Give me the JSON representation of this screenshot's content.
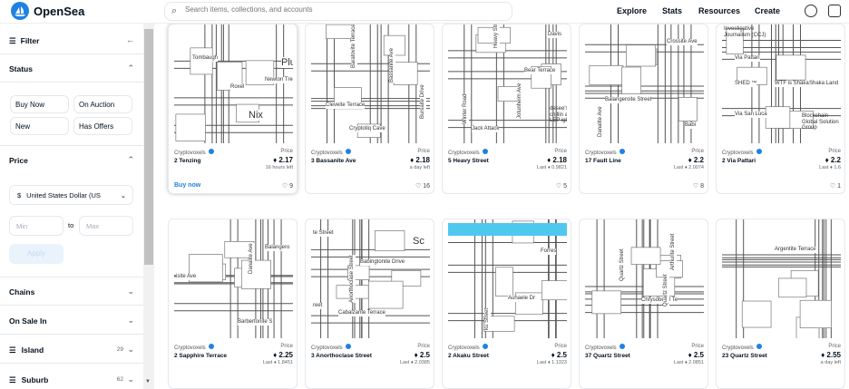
{
  "brand": {
    "name": "OpenSea"
  },
  "search": {
    "placeholder": "Search items, collections, and accounts"
  },
  "nav": [
    "Explore",
    "Stats",
    "Resources",
    "Create"
  ],
  "sidebar": {
    "filter": "Filter",
    "status": "Status",
    "status_options": [
      "Buy Now",
      "On Auction",
      "New",
      "Has Offers"
    ],
    "price": "Price",
    "currency": "United States Dollar (US",
    "currency_symbol": "$",
    "min": "Min",
    "to": "to",
    "max": "Max",
    "apply": "Apply",
    "chains": "Chains",
    "on_sale": "On Sale In",
    "island": "Island",
    "island_count": "29",
    "suburb": "Suburb",
    "suburb_count": "62"
  },
  "cards": [
    {
      "collection": "Cryptovoxels",
      "name": "2 Tenzing",
      "price_label": "Price",
      "price": "2.17",
      "sub": "16 hours left",
      "fav": "9",
      "buy": "Buy now",
      "map": [
        "Tombaugh",
        "Roxel",
        "Newton Tree",
        "Nix",
        "Plu"
      ]
    },
    {
      "collection": "Cryptovoxels",
      "name": "3 Bassanite Ave",
      "price_label": "Price",
      "price": "2.18",
      "sub": "a day left",
      "fav": "16",
      "map": [
        "Baratovite Terrace",
        "Bassanite Ave",
        "Cleveite Terrace",
        "Cryptotiq Cave",
        "Bursaite Drive"
      ]
    },
    {
      "collection": "Cryptovoxels",
      "name": "5 Heavy Street",
      "price_label": "Price",
      "price": "2.18",
      "sub": "Last ♦ 0.9821",
      "fav": "5",
      "map": [
        "Davis",
        "Heavy Street",
        "Bear Terrace",
        "Winter Road",
        "Jack Attack",
        "desee's jus chillin aka LEP igloo",
        "Jotunheim Ave"
      ]
    },
    {
      "collection": "Cryptovoxels",
      "name": "17 Fault Line",
      "price_label": "Price",
      "price": "2.2",
      "sub": "Last ♦ 2.0074",
      "fav": "8",
      "map": [
        "Crossite Ave",
        "Balangeroite Street",
        "Danalite Ave",
        "Babi"
      ]
    },
    {
      "collection": "Cryptovoxels",
      "name": "2 Via Pattari",
      "price_label": "Price",
      "price": "2.2",
      "sub": "Last ♦ 1.6",
      "fav": "1",
      "map": [
        "Investigative Journalism (CCJ)",
        "Via Pattari",
        "SHED ™",
        "WTF is Shaka",
        "Shaka Land",
        "Via San Luca",
        "Blockchain Global Solution Group"
      ]
    },
    {
      "collection": "Cryptovoxels",
      "name": "2 Sapphire Terrace",
      "price_label": "Price",
      "price": "2.25",
      "sub": "Last ♦ 1.8451",
      "map": [
        "Balangero",
        "Danalite Ave",
        "isite Ave",
        "Barbertonite S"
      ]
    },
    {
      "collection": "Cryptovoxels",
      "name": "3 Anorthoclase Street",
      "price_label": "Price",
      "price": "2.5",
      "sub": "Last ♦ 2.0385",
      "map": [
        "te Street",
        "Sc",
        "Babingtonite Drive",
        "Anorthoclase Street",
        "reet",
        "Cabalzarite Terrace"
      ]
    },
    {
      "collection": "Cryptovoxels",
      "name": "2 Akaku Street",
      "price_label": "Price",
      "price": "2.5",
      "sub": "Last ♦ 1.1323",
      "map": [
        "Forres",
        "Auhaele Dr",
        "ku Street"
      ]
    },
    {
      "collection": "Cryptovoxels",
      "name": "37 Quartz Street",
      "price_label": "Price",
      "price": "2.5",
      "sub": "Last ♦ 2.0851",
      "map": [
        "Arthurite Street",
        "Quartz Street",
        "Chrysoberyl Te",
        "Quartz Street"
      ]
    },
    {
      "collection": "Cryptovoxels",
      "name": "23 Quartz Street",
      "price_label": "Price",
      "price": "2.55",
      "sub": "a day left",
      "map": [
        "Argentite Terrace"
      ]
    }
  ]
}
